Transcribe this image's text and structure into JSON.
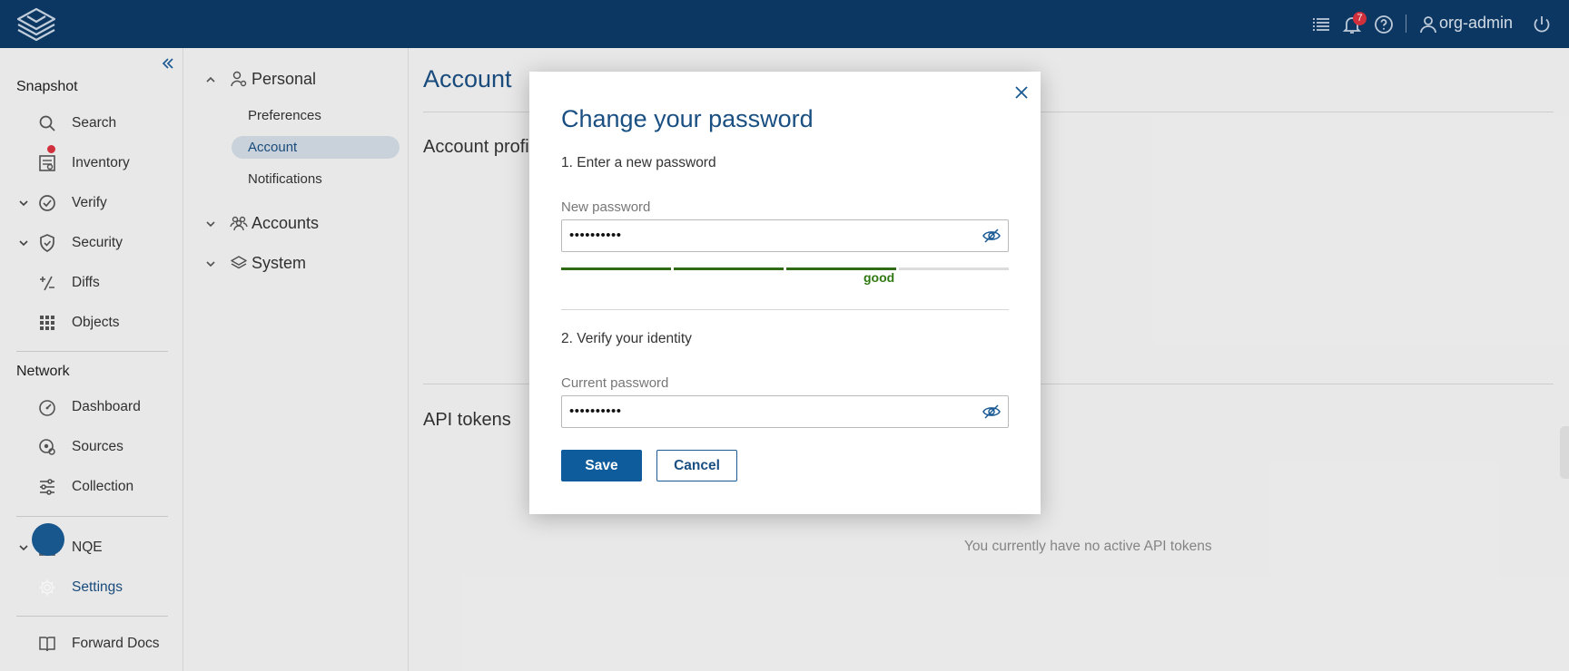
{
  "topbar": {
    "notifications_count": "7",
    "user_name": "org-admin",
    "icons": [
      "forward-logo-icon",
      "list-icon",
      "bell-icon",
      "help-icon",
      "user-icon",
      "power-icon"
    ]
  },
  "sidebar": {
    "sections": [
      {
        "title": "Snapshot"
      },
      {
        "title": "Network"
      }
    ],
    "items": [
      {
        "label": "Search",
        "icon": "search-icon"
      },
      {
        "label": "Inventory",
        "icon": "inventory-icon"
      },
      {
        "label": "Verify",
        "icon": "verify-icon",
        "expandable": true,
        "alert": true
      },
      {
        "label": "Security",
        "icon": "shield-icon",
        "expandable": true
      },
      {
        "label": "Diffs",
        "icon": "diffs-icon"
      },
      {
        "label": "Objects",
        "icon": "grid-icon"
      },
      {
        "label": "Dashboard",
        "icon": "dashboard-icon"
      },
      {
        "label": "Sources",
        "icon": "sources-icon"
      },
      {
        "label": "Collection",
        "icon": "sliders-icon"
      },
      {
        "label": "NQE",
        "icon": "code-icon",
        "expandable": true
      },
      {
        "label": "Settings",
        "icon": "gear-icon",
        "selected": true
      },
      {
        "label": "Forward Docs",
        "icon": "book-icon"
      }
    ]
  },
  "subnav": {
    "groups": [
      {
        "label": "Personal",
        "icon": "user-gear-icon",
        "expanded": true
      },
      {
        "label": "Accounts",
        "icon": "users-icon",
        "expanded": false
      },
      {
        "label": "System",
        "icon": "layers-icon",
        "expanded": false
      }
    ],
    "personal_items": [
      {
        "label": "Preferences"
      },
      {
        "label": "Account",
        "selected": true
      },
      {
        "label": "Notifications"
      }
    ]
  },
  "main": {
    "title": "Account",
    "profile_heading": "Account profi",
    "api_tokens_heading": "API tokens",
    "empty_tokens_text": "You currently have no active API tokens"
  },
  "modal": {
    "title": "Change your password",
    "step1": "1. Enter a new password",
    "new_password_label": "New password",
    "new_password_value": "••••••••••",
    "strength_label": "good",
    "strength_level": 0.75,
    "step2": "2. Verify your identity",
    "current_password_label": "Current password",
    "current_password_value": "••••••••••",
    "save_label": "Save",
    "cancel_label": "Cancel",
    "colors": {
      "accent": "#0f5c9c",
      "strength_on": "#2f6b14",
      "strength_off": "#dcdcdc"
    }
  }
}
